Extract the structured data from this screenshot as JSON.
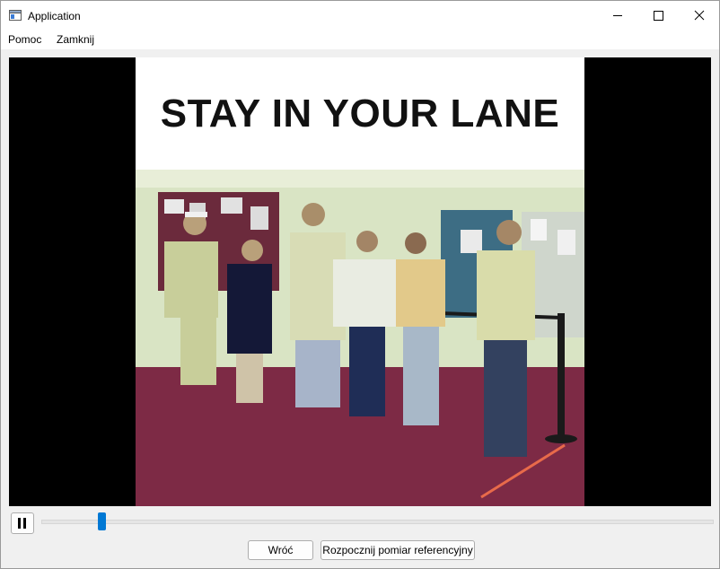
{
  "window": {
    "title": "Application",
    "controls": [
      "minimize-icon",
      "maximize-icon",
      "close-icon"
    ]
  },
  "menu": {
    "items": [
      "Pomoc",
      "Zamknij"
    ]
  },
  "video": {
    "caption": "STAY IN YOUR LANE"
  },
  "player": {
    "playback_state": "playing",
    "pause_icon": "pause-icon",
    "progress": 0.09
  },
  "buttons": {
    "back": "Wróć",
    "start_reference": "Rozpocznij pomiar referencyjny"
  },
  "colors": {
    "accent": "#0078d4",
    "video_background": "#000000",
    "floor": "#7d2a45",
    "wall": "#d9e4c4"
  }
}
